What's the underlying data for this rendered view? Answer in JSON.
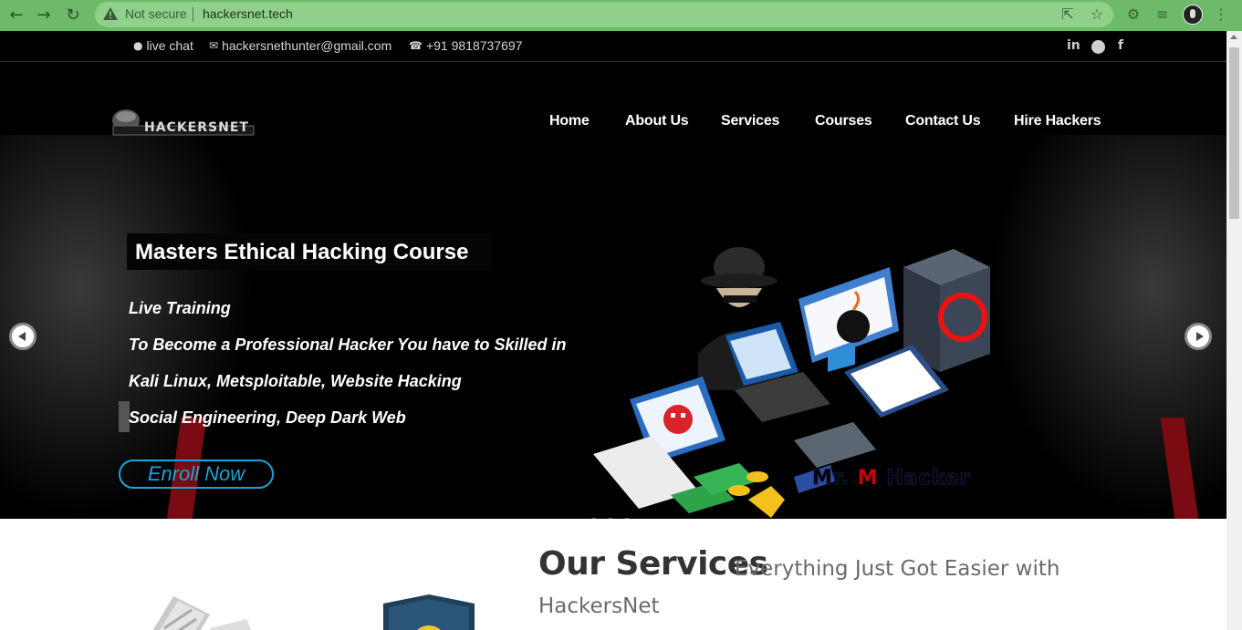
{
  "browser": {
    "security_label": "Not secure",
    "url": "hackersnet.tech",
    "icons": [
      "back-icon",
      "forward-icon",
      "reload-icon",
      "warning-icon",
      "share-icon",
      "star-icon",
      "extensions-icon",
      "reading-list-icon",
      "profile-avatar",
      "menu-icon"
    ]
  },
  "topbar": {
    "chat_label": "live chat",
    "email": "hackersnethunter@gmail.com",
    "phone": "+91 9818737697",
    "social": [
      "linkedin-icon",
      "telegram-icon",
      "facebook-icon"
    ]
  },
  "nav": {
    "logo_text": "HACKERSNET",
    "items": [
      {
        "label": "Home"
      },
      {
        "label": "About Us"
      },
      {
        "label": "Services"
      },
      {
        "label": "Courses"
      },
      {
        "label": "Contact Us"
      },
      {
        "label": "Hire Hackers"
      }
    ]
  },
  "hero": {
    "title": "Masters Ethical Hacking Course",
    "lines": [
      "Live Training",
      "To Become a Professional Hacker You have to Skilled in",
      "Kali Linux, Metsploitable, Website Hacking",
      "Social Engineering, Deep Dark Web"
    ],
    "cta": "Enroll Now",
    "brand_prefix": "Mr.",
    "brand_m": "M",
    "brand_suffix": "Hacker",
    "slide_count": 3,
    "active_slide": 2
  },
  "services": {
    "title": "Our Services",
    "subtitle_part1": "Everything Just Got Easier with",
    "subtitle_part2": "HackersNet"
  },
  "colors": {
    "chrome": "#6dbb6a",
    "accent": "#1aa3d9",
    "hero_bg": "#000000"
  }
}
